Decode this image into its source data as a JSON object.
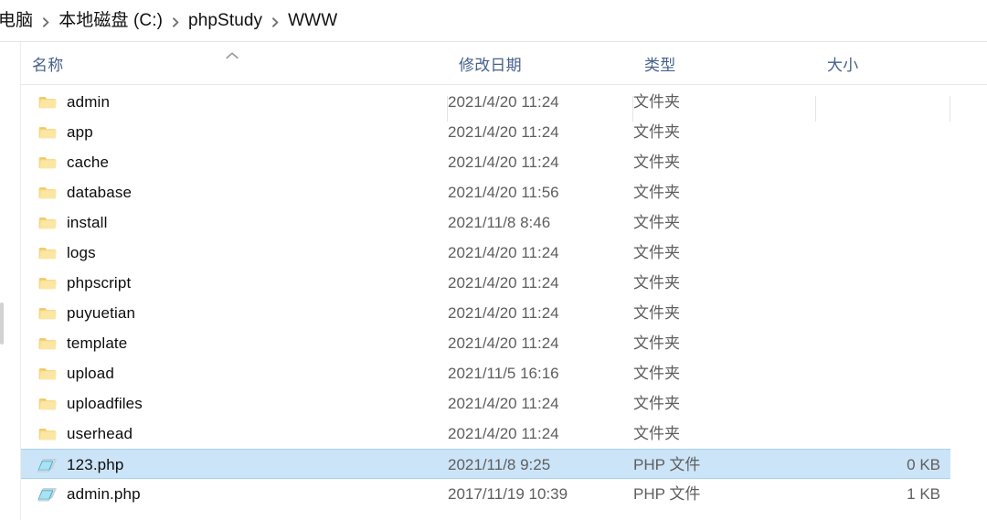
{
  "window": {
    "app": "Windows File Explorer",
    "accent_selection_color": "#cce4f7",
    "selection_border_color": "#a8d2f0",
    "folder_icon_color": "#f7d781",
    "php_icon_color": "#9fd6ea",
    "header_text_color": "#45618a"
  },
  "breadcrumb": {
    "items": [
      {
        "label": "电脑"
      },
      {
        "label": "本地磁盘 (C:)"
      },
      {
        "label": "phpStudy"
      },
      {
        "label": "WWW"
      }
    ],
    "separator_icon": "chevron-right-icon"
  },
  "columns": {
    "sort_indicator_icon": "chevron-up-icon",
    "sorted_by": "名称",
    "sort_direction": "ascending",
    "headers": [
      {
        "key": "name",
        "label": "名称"
      },
      {
        "key": "date",
        "label": "修改日期"
      },
      {
        "key": "type",
        "label": "类型"
      },
      {
        "key": "size",
        "label": "大小"
      }
    ]
  },
  "files": [
    {
      "name": "admin",
      "date": "2021/4/20 11:24",
      "type": "文件夹",
      "size": "",
      "icon": "folder-icon",
      "selected": false
    },
    {
      "name": "app",
      "date": "2021/4/20 11:24",
      "type": "文件夹",
      "size": "",
      "icon": "folder-icon",
      "selected": false
    },
    {
      "name": "cache",
      "date": "2021/4/20 11:24",
      "type": "文件夹",
      "size": "",
      "icon": "folder-icon",
      "selected": false
    },
    {
      "name": "database",
      "date": "2021/4/20 11:56",
      "type": "文件夹",
      "size": "",
      "icon": "folder-icon",
      "selected": false
    },
    {
      "name": "install",
      "date": "2021/11/8 8:46",
      "type": "文件夹",
      "size": "",
      "icon": "folder-icon",
      "selected": false
    },
    {
      "name": "logs",
      "date": "2021/4/20 11:24",
      "type": "文件夹",
      "size": "",
      "icon": "folder-icon",
      "selected": false
    },
    {
      "name": "phpscript",
      "date": "2021/4/20 11:24",
      "type": "文件夹",
      "size": "",
      "icon": "folder-icon",
      "selected": false
    },
    {
      "name": "puyuetian",
      "date": "2021/4/20 11:24",
      "type": "文件夹",
      "size": "",
      "icon": "folder-icon",
      "selected": false
    },
    {
      "name": "template",
      "date": "2021/4/20 11:24",
      "type": "文件夹",
      "size": "",
      "icon": "folder-icon",
      "selected": false
    },
    {
      "name": "upload",
      "date": "2021/11/5 16:16",
      "type": "文件夹",
      "size": "",
      "icon": "folder-icon",
      "selected": false
    },
    {
      "name": "uploadfiles",
      "date": "2021/4/20 11:24",
      "type": "文件夹",
      "size": "",
      "icon": "folder-icon",
      "selected": false
    },
    {
      "name": "userhead",
      "date": "2021/4/20 11:24",
      "type": "文件夹",
      "size": "",
      "icon": "folder-icon",
      "selected": false
    },
    {
      "name": "123.php",
      "date": "2021/11/8 9:25",
      "type": "PHP 文件",
      "size": "0 KB",
      "icon": "php-file-icon",
      "selected": true
    },
    {
      "name": "admin.php",
      "date": "2017/11/19 10:39",
      "type": "PHP 文件",
      "size": "1 KB",
      "icon": "php-file-icon",
      "selected": false
    }
  ]
}
